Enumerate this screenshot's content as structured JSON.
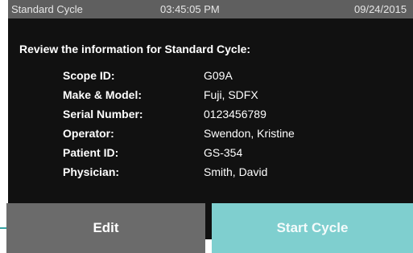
{
  "status_bar": {
    "title": "Standard Cycle",
    "time": "03:45:05 PM",
    "date": "09/24/2015"
  },
  "review": {
    "heading": "Review the information for Standard Cycle:",
    "rows": [
      {
        "label": "Scope ID:",
        "value": "G09A"
      },
      {
        "label": "Make & Model:",
        "value": "Fuji, SDFX"
      },
      {
        "label": "Serial Number:",
        "value": "0123456789"
      },
      {
        "label": "Operator:",
        "value": "Swendon, Kristine"
      },
      {
        "label": "Patient ID:",
        "value": "GS-354"
      },
      {
        "label": "Physician:",
        "value": "Smith, David"
      }
    ]
  },
  "actions": {
    "edit_label": "Edit",
    "start_label": "Start Cycle"
  },
  "colors": {
    "status_bar_bg": "#5f5f5f",
    "screen_bg": "#111111",
    "edit_button_bg": "#6b6b6b",
    "start_button_bg": "#7fcfcf"
  }
}
